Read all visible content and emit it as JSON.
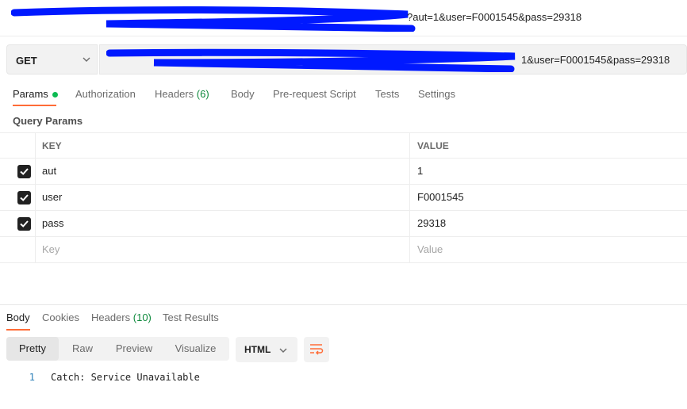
{
  "title_bar": {
    "url_tail": "?aut=1&user=F0001545&pass=29318"
  },
  "request": {
    "method": "GET",
    "url_tail": "1&user=F0001545&pass=29318"
  },
  "request_tabs": [
    {
      "label": "Params",
      "active": true
    },
    {
      "label": "Authorization"
    },
    {
      "label": "Headers",
      "count": "(6)"
    },
    {
      "label": "Body"
    },
    {
      "label": "Pre-request Script"
    },
    {
      "label": "Tests"
    },
    {
      "label": "Settings"
    }
  ],
  "query_params": {
    "title": "Query Params",
    "key_header": "KEY",
    "value_header": "VALUE",
    "rows": [
      {
        "key": "aut",
        "value": "1",
        "checked": true
      },
      {
        "key": "user",
        "value": "F0001545",
        "checked": true
      },
      {
        "key": "pass",
        "value": "29318",
        "checked": true
      }
    ],
    "key_placeholder": "Key",
    "value_placeholder": "Value"
  },
  "response_tabs": [
    {
      "label": "Body",
      "active": true
    },
    {
      "label": "Cookies"
    },
    {
      "label": "Headers",
      "count": "(10)"
    },
    {
      "label": "Test Results"
    }
  ],
  "response_views": [
    "Pretty",
    "Raw",
    "Preview",
    "Visualize"
  ],
  "response_format": "HTML",
  "response_body": {
    "line_number": "1",
    "text": "Catch: Service Unavailable"
  },
  "colors": {
    "accent": "#ff6c37",
    "params_dot": "#0cbb52",
    "count_green": "#0f8a3d",
    "redaction": "#0019ff"
  },
  "icons": [
    "chevron-down-icon",
    "checkmark-icon",
    "wrap-lines-icon"
  ]
}
